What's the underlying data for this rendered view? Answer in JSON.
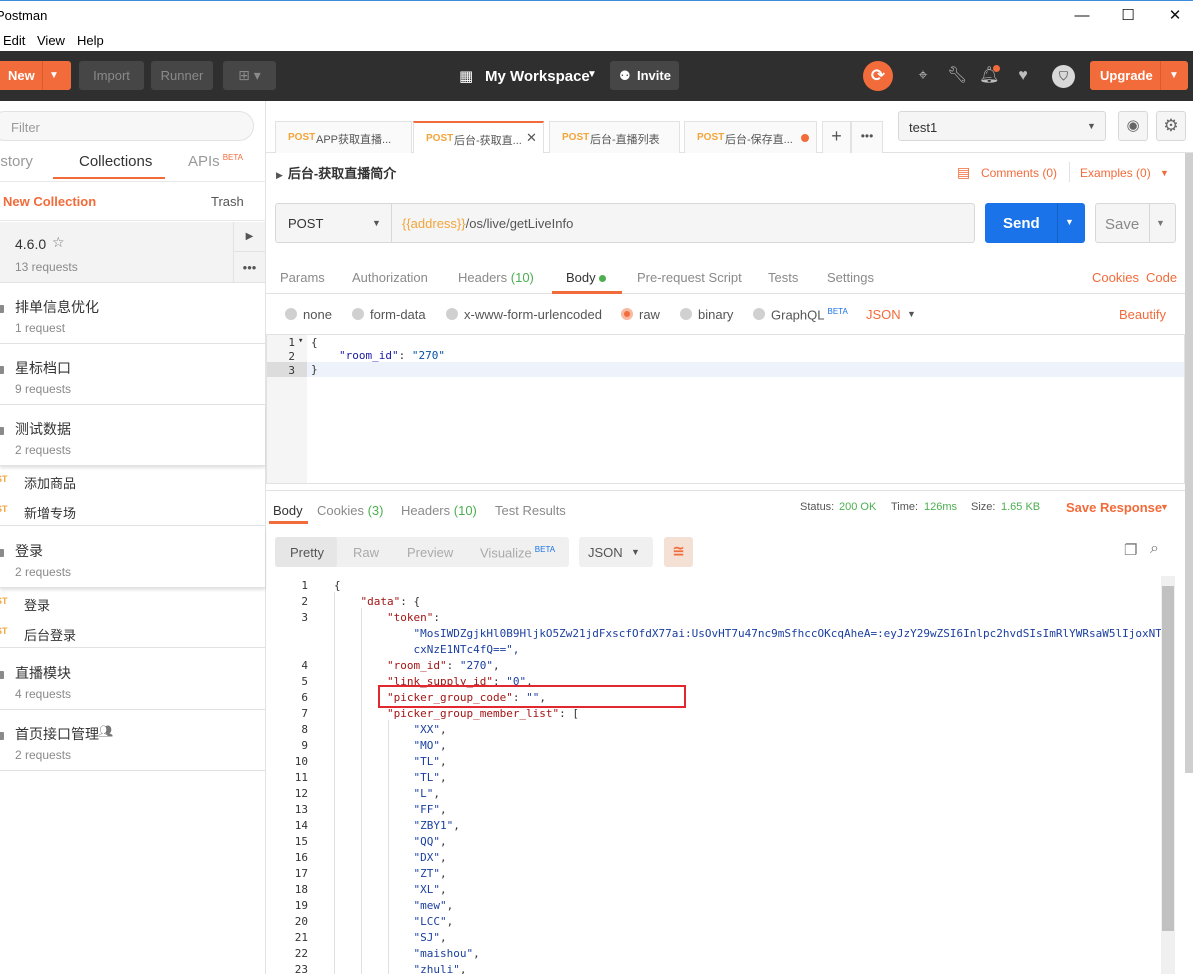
{
  "window": {
    "title": "Postman",
    "minimize": "—",
    "maximize": "☐",
    "close": "✕"
  },
  "menu": [
    "Edit",
    "View",
    "Help"
  ],
  "header": {
    "new_label": "New",
    "import_label": "Import",
    "runner_label": "Runner",
    "workspace_label": "My Workspace",
    "invite_label": "Invite",
    "upgrade_label": "Upgrade"
  },
  "sidebar": {
    "filter_placeholder": "Filter",
    "tabs": [
      "History",
      "Collections",
      "APIs"
    ],
    "apis_badge": "BETA",
    "new_collection": "New Collection",
    "trash": "Trash",
    "collections": [
      {
        "name": "4.6.0",
        "sub": "13 requests"
      },
      {
        "name": "排单信息优化",
        "sub": "1 request"
      },
      {
        "name": "星标档口",
        "sub": "9 requests"
      },
      {
        "name": "测试数据",
        "sub": "2 requests"
      }
    ],
    "req1": {
      "method": "POST",
      "name": "添加商品"
    },
    "req2": {
      "method": "POST",
      "name": "新增专场"
    },
    "coll_login": {
      "name": "登录",
      "sub": "2 requests"
    },
    "req3": {
      "method": "POST",
      "name": "登录"
    },
    "req4": {
      "method": "POST",
      "name": "后台登录"
    },
    "coll_live": {
      "name": "直播模块",
      "sub": "4 requests"
    },
    "coll_home": {
      "name": "首页接口管理",
      "sub": "2 requests"
    }
  },
  "tabs": [
    {
      "method": "POST",
      "name": "APP获取直播..."
    },
    {
      "method": "POST",
      "name": "后台-获取直..."
    },
    {
      "method": "POST",
      "name": "后台-直播列表"
    },
    {
      "method": "POST",
      "name": "后台-保存直..."
    }
  ],
  "environment": {
    "selected": "test1"
  },
  "request": {
    "title": "后台-获取直播简介",
    "comments": "Comments (0)",
    "examples": "Examples (0)",
    "method": "POST",
    "url_var": "{{address}}",
    "url_path": "/os/live/getLiveInfo",
    "send": "Send",
    "save": "Save",
    "subtabs": [
      "Params",
      "Authorization",
      "Headers",
      "Body",
      "Pre-request Script",
      "Tests",
      "Settings"
    ],
    "headers_count": "(10)",
    "cookies": "Cookies",
    "code": "Code",
    "body_types": [
      "none",
      "form-data",
      "x-www-form-urlencoded",
      "raw",
      "binary",
      "GraphQL"
    ],
    "graphql_badge": "BETA",
    "format": "JSON",
    "beautify": "Beautify",
    "body_lines": [
      "1",
      "2",
      "3"
    ],
    "body_l1": "{",
    "body_key": "\"room_id\"",
    "body_colon": ": ",
    "body_val": "\"270\"",
    "body_l3": "}"
  },
  "response": {
    "tabs": [
      "Body",
      "Cookies",
      "Headers",
      "Test Results"
    ],
    "cookies_count": "(3)",
    "headers_count": "(10)",
    "status_label": "Status:",
    "status": "200 OK",
    "time_label": "Time:",
    "time": "126ms",
    "size_label": "Size:",
    "size": "1.65 KB",
    "save_response": "Save Response",
    "views": [
      "Pretty",
      "Raw",
      "Preview",
      "Visualize"
    ],
    "visualize_badge": "BETA",
    "format": "JSON",
    "lines": [
      {
        "n": "1",
        "t": "{"
      },
      {
        "n": "2",
        "t": "    \"data\": {"
      },
      {
        "n": "3",
        "t": "        \"token\":"
      },
      {
        "n": "",
        "t": "            \"MosIWDZgjkHl0B9HljkO5Zw21jdFxscfOfdX77ai:UsOvHT7u47nc9mSfhccOKcqAheA=:eyJzY29wZSI6Inlpc2hvdSIsImRlYWRsaW5lIjoxNT"
      },
      {
        "n": "",
        "t": "            cxNzE1NTc4fQ==\","
      },
      {
        "n": "4",
        "t": "        \"room_id\": \"270\","
      },
      {
        "n": "5",
        "t": "        \"link_supply_id\": \"0\","
      },
      {
        "n": "6",
        "t": "        \"picker_group_code\": \"\","
      },
      {
        "n": "7",
        "t": "        \"picker_group_member_list\": ["
      },
      {
        "n": "8",
        "t": "            \"XX\","
      },
      {
        "n": "9",
        "t": "            \"MO\","
      },
      {
        "n": "10",
        "t": "            \"TL\","
      },
      {
        "n": "11",
        "t": "            \"TL\","
      },
      {
        "n": "12",
        "t": "            \"L\","
      },
      {
        "n": "13",
        "t": "            \"FF\","
      },
      {
        "n": "14",
        "t": "            \"ZBY1\","
      },
      {
        "n": "15",
        "t": "            \"QQ\","
      },
      {
        "n": "16",
        "t": "            \"DX\","
      },
      {
        "n": "17",
        "t": "            \"ZT\","
      },
      {
        "n": "18",
        "t": "            \"XL\","
      },
      {
        "n": "19",
        "t": "            \"mew\","
      },
      {
        "n": "20",
        "t": "            \"LCC\","
      },
      {
        "n": "21",
        "t": "            \"SJ\","
      },
      {
        "n": "22",
        "t": "            \"maishou\","
      },
      {
        "n": "23",
        "t": "            \"zhuli\","
      }
    ]
  },
  "colors": {
    "accent": "#f26b3a",
    "send": "#1a73e8",
    "status_ok": "#4caf50",
    "highlight": "#e0282e"
  }
}
